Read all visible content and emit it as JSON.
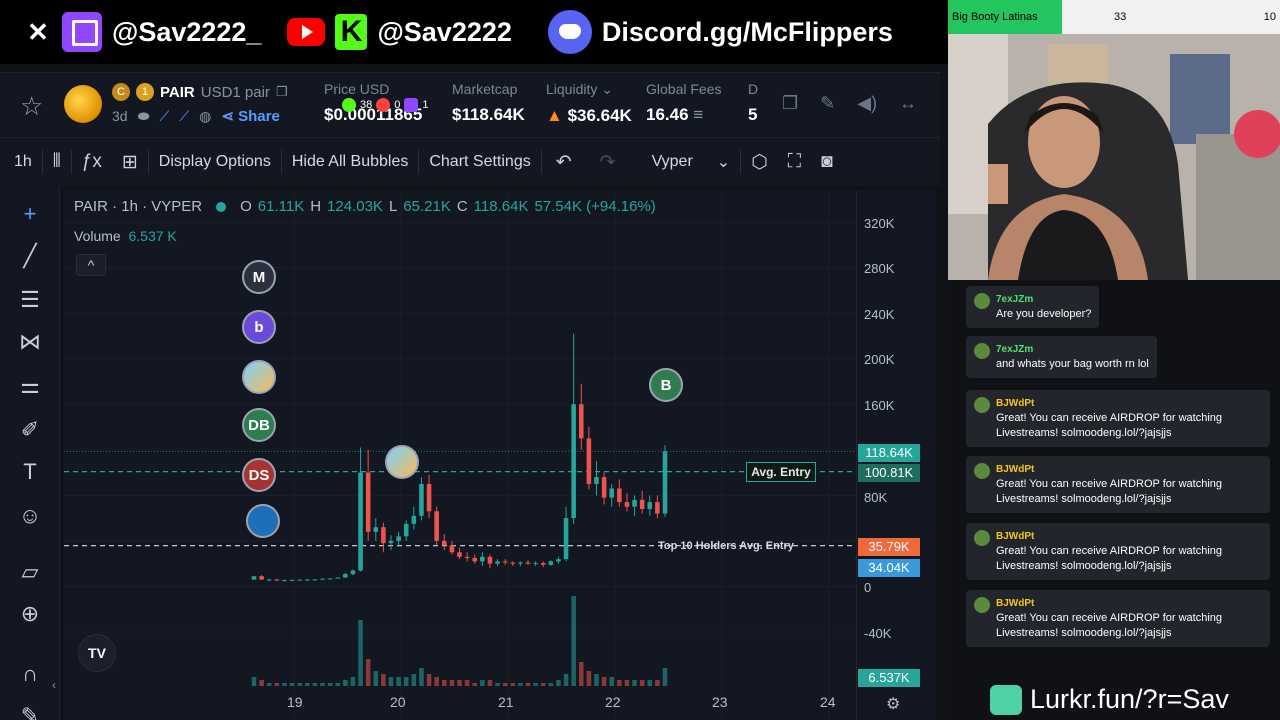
{
  "overlay": {
    "x_icon": "x-logo-icon",
    "twitch_handle": "@Sav2222_",
    "kick_handle": "@Sav2222",
    "discord": "Discord.gg/McFlippers",
    "kick_letter": "K"
  },
  "pair": {
    "name": "PAIR",
    "quote": "USD1 pair",
    "rank": "1",
    "age": "3d",
    "share": "Share"
  },
  "stats": [
    {
      "label": "Price USD",
      "value": "$0.00011865"
    },
    {
      "label": "Marketcap",
      "value": "$118.64K"
    },
    {
      "label": "Liquidity",
      "value": "$36.64K"
    },
    {
      "label": "Global Fees",
      "value": "16.46"
    },
    {
      "label": "D",
      "value": "5"
    }
  ],
  "counts": {
    "a": "38",
    "b": "0",
    "c": "1"
  },
  "toolbar": {
    "interval": "1h",
    "display_options": "Display Options",
    "hide_bubbles": "Hide All Bubbles",
    "chart_settings": "Chart Settings",
    "provider": "Vyper"
  },
  "legend": {
    "title": "PAIR · 1h · VYPER",
    "o_label": "O",
    "o": "61.11K",
    "h_label": "H",
    "h": "124.03K",
    "l_label": "L",
    "l": "65.21K",
    "c_label": "C",
    "c": "118.64K",
    "change": "57.54K (+94.16%)",
    "volume_label": "Volume",
    "volume": "6.537 K"
  },
  "bubbles": [
    "M",
    "b",
    "",
    "DB",
    "DS",
    ""
  ],
  "marker_b": "B",
  "avg_entry": "Avg. Entry",
  "top10_entry": "Top 10 Holders Avg. Entry",
  "tv_logo": "TV",
  "colors": {
    "up": "#26a69a",
    "down": "#ef5350",
    "bg": "#131722"
  },
  "chart_data": {
    "type": "candlestick",
    "x_ticks": [
      "19",
      "20",
      "21",
      "22",
      "23",
      "24"
    ],
    "y_ticks": [
      "320K",
      "280K",
      "240K",
      "200K",
      "160K",
      "80K",
      "0",
      "-40K"
    ],
    "ylim": [
      -40000,
      320000
    ],
    "price_tags": [
      "118.64K",
      "100.81K",
      "35.79K",
      "34.04K",
      "6.537K"
    ],
    "lines": [
      {
        "name": "Avg. Entry",
        "value": 100810
      },
      {
        "name": "Top 10 Holders Avg. Entry",
        "value": 35790
      }
    ],
    "candles": [
      [
        6000,
        6000,
        6000,
        9000
      ],
      [
        9000,
        10000,
        8000,
        6000
      ],
      [
        6000,
        7000,
        5000,
        6000
      ],
      [
        6000,
        6500,
        5000,
        5500
      ],
      [
        5500,
        6000,
        5000,
        5500
      ],
      [
        5500,
        6000,
        5000,
        5800
      ],
      [
        5800,
        6200,
        5500,
        6000
      ],
      [
        6000,
        6500,
        5500,
        6000
      ],
      [
        6000,
        6500,
        5500,
        6200
      ],
      [
        6200,
        7000,
        6000,
        6800
      ],
      [
        6800,
        7200,
        6500,
        7000
      ],
      [
        7000,
        8000,
        6800,
        7800
      ],
      [
        7800,
        12000,
        7500,
        11000
      ],
      [
        11000,
        15000,
        10000,
        14000
      ],
      [
        14000,
        122000,
        13000,
        100000
      ],
      [
        100000,
        120000,
        40000,
        48000
      ],
      [
        48000,
        60000,
        40000,
        52000
      ],
      [
        52000,
        56000,
        30000,
        38000
      ],
      [
        38000,
        45000,
        32000,
        40000
      ],
      [
        40000,
        48000,
        36000,
        44000
      ],
      [
        44000,
        58000,
        40000,
        55000
      ],
      [
        55000,
        70000,
        50000,
        62000
      ],
      [
        62000,
        96000,
        58000,
        90000
      ],
      [
        90000,
        98000,
        60000,
        66000
      ],
      [
        66000,
        70000,
        36000,
        40000
      ],
      [
        40000,
        46000,
        32000,
        36000
      ],
      [
        36000,
        40000,
        28000,
        30000
      ],
      [
        30000,
        34000,
        24000,
        26000
      ],
      [
        26000,
        30000,
        22000,
        25000
      ],
      [
        25000,
        28000,
        20000,
        22000
      ],
      [
        22000,
        30000,
        18000,
        26000
      ],
      [
        26000,
        28000,
        16000,
        20000
      ],
      [
        20000,
        24000,
        18000,
        22000
      ],
      [
        22000,
        24000,
        19000,
        21000
      ],
      [
        21000,
        22000,
        18000,
        20000
      ],
      [
        20000,
        22000,
        18000,
        21000
      ],
      [
        21000,
        23000,
        19000,
        20000
      ],
      [
        20000,
        22000,
        18000,
        20500
      ],
      [
        20500,
        22000,
        17000,
        19000
      ],
      [
        19000,
        23000,
        18000,
        22000
      ],
      [
        22000,
        26000,
        20000,
        24000
      ],
      [
        24000,
        70000,
        22000,
        60000
      ],
      [
        60000,
        222000,
        55000,
        160000
      ],
      [
        160000,
        178000,
        120000,
        130000
      ],
      [
        130000,
        140000,
        85000,
        90000
      ],
      [
        90000,
        110000,
        80000,
        96000
      ],
      [
        96000,
        100000,
        72000,
        78000
      ],
      [
        78000,
        90000,
        70000,
        86000
      ],
      [
        86000,
        94000,
        70000,
        74000
      ],
      [
        74000,
        82000,
        66000,
        70000
      ],
      [
        70000,
        80000,
        62000,
        76000
      ],
      [
        76000,
        84000,
        64000,
        68000
      ],
      [
        68000,
        80000,
        62000,
        74000
      ],
      [
        74000,
        80000,
        60000,
        64000
      ],
      [
        64000,
        124030,
        61110,
        118640
      ]
    ],
    "volume": [
      3,
      2,
      1,
      1,
      1,
      1,
      1,
      1,
      1,
      1,
      1,
      1,
      2,
      3,
      22,
      9,
      5,
      4,
      3,
      3,
      3,
      4,
      6,
      4,
      3,
      2,
      2,
      2,
      2,
      1,
      2,
      2,
      1,
      1,
      1,
      1,
      1,
      1,
      1,
      1,
      2,
      4,
      30,
      8,
      5,
      4,
      3,
      3,
      2,
      2,
      2,
      2,
      2,
      2,
      6
    ]
  },
  "stream": {
    "goal_label": "Big Booty Latinas",
    "goal_a": "33",
    "goal_b": "10",
    "chat": [
      {
        "user": "7exJZm",
        "text": "Are you developer?"
      },
      {
        "user": "7exJZm",
        "text": "and whats your bag worth rn lol"
      },
      {
        "user": "BJWdPt",
        "text": "Great! You can receive AIRDROP for watching Livestreams! solmoodeng.lol/?jajsjjs"
      },
      {
        "user": "BJWdPt",
        "text": "Great! You can receive AIRDROP for watching Livestreams! solmoodeng.lol/?jajsjjs"
      },
      {
        "user": "BJWdPt",
        "text": "Great! You can receive AIRDROP for watching Livestreams! solmoodeng.lol/?jajsjjs"
      },
      {
        "user": "BJWdPt",
        "text": "Great! You can receive AIRDROP for watching Livestreams! solmoodeng.lol/?jajsjjs"
      }
    ],
    "lurkr": "Lurkr.fun/?r=Sav"
  }
}
